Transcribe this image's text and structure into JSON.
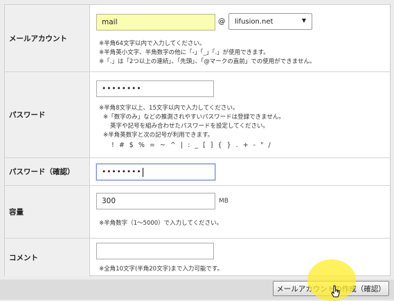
{
  "rows": {
    "mail_account": {
      "label": "メールアカウント",
      "value": "mail",
      "at": "@",
      "domain": "lifusion.net",
      "notes": [
        "※半角64文字以内で入力してください。",
        "※半角英小文字、半角数字の他に「-」「_」「.」が使用できます。",
        "※「.」は「2つ以上の連続」、「先頭」、「@マークの直前」での使用ができません。"
      ]
    },
    "password": {
      "label": "パスワード",
      "value": "••••••••",
      "notes": [
        "※半角8文字以上、15文字以内で入力してください。",
        "※「数字のみ」などの推測されやすいパスワードは登録できません。",
        "英字や記号を組み合わせたパスワードを設定してください。",
        "※半角英数字と次の記号が利用できます。",
        "! # $ % = ~ ^ | : _ [ ] { } . + - \" /"
      ]
    },
    "password_confirm": {
      "label": "パスワード（確認）",
      "value": "••••••••"
    },
    "capacity": {
      "label": "容量",
      "value": "300",
      "unit": "MB",
      "note": "※半角数字（1～5000）で入力してください。"
    },
    "comment": {
      "label": "コメント",
      "value": "",
      "note": "※全角10文字(半角20文字)まで入力可能です。"
    }
  },
  "submit_label": "メールアカウントの作成（確認）",
  "colors": {
    "label_bg": "#efefef",
    "autofill": "#fbfdb2",
    "highlight": "#ffee28"
  }
}
